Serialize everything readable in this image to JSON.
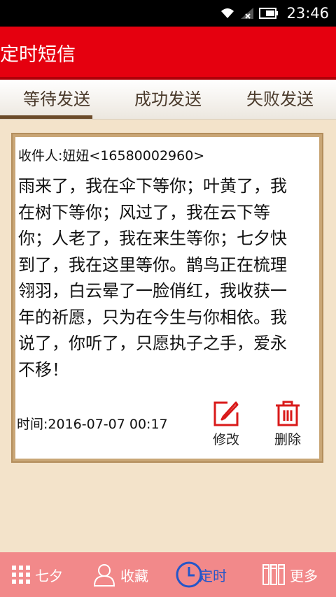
{
  "status_bar": {
    "time": "23:46"
  },
  "app_bar": {
    "title": "定时短信"
  },
  "tabs": [
    {
      "label": "等待发送",
      "active": true
    },
    {
      "label": "成功发送",
      "active": false
    },
    {
      "label": "失败发送",
      "active": false
    }
  ],
  "message_card": {
    "recipient": "收件人:妞妞<16580002960>",
    "lines": [
      "雨来了，我在伞下等你；叶黄了，我",
      "在树下等你；风过了，我在云下等",
      "你；人老了，我在来生等你；七夕快",
      "到了，我在这里等你。鹊鸟正在梳理",
      "翎羽，白云晕了一脸俏红，我收获一",
      "年的祈愿，只为在今生与你相依。我",
      "说了，你听了，只愿执子之手，爱永",
      "不移！"
    ],
    "send_time": "时间:2016-07-07 00:17",
    "edit_label": "修改",
    "delete_label": "删除"
  },
  "bottom_nav": [
    {
      "label": "七夕",
      "icon": "grid-icon",
      "active": false
    },
    {
      "label": "收藏",
      "icon": "person-icon",
      "active": false
    },
    {
      "label": "定时",
      "icon": "clock-icon",
      "active": true
    },
    {
      "label": "更多",
      "icon": "books-icon",
      "active": false
    }
  ],
  "colors": {
    "accent_red": "#e5000f",
    "nav_bg": "#f2898a",
    "nav_active": "#2456c9",
    "background": "#f3e3ca"
  }
}
